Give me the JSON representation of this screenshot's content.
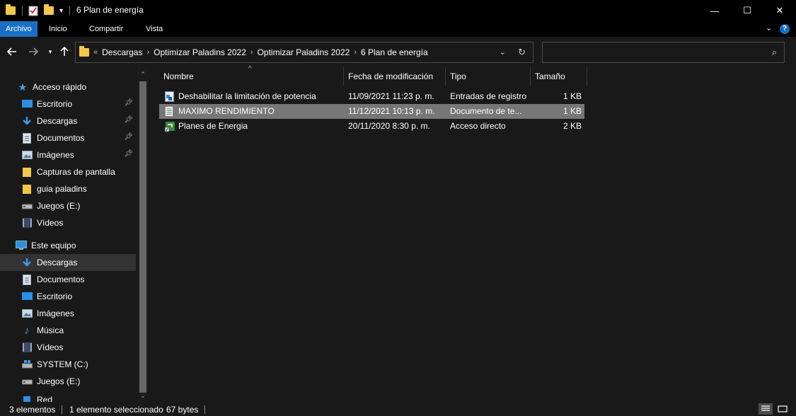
{
  "window": {
    "title": "6 Plan de energía",
    "minimize_glyph": "—",
    "maximize_glyph": "☐",
    "close_glyph": "✕"
  },
  "ribbon": {
    "tabs": [
      "Archivo",
      "Inicio",
      "Compartir",
      "Vista"
    ],
    "active_tab": "Archivo",
    "help_glyph": "?"
  },
  "nav": {
    "breadcrumb": [
      "Descargas",
      "Optimizar Paladins 2022",
      "Optimizar Paladins 2022",
      "6 Plan de energía"
    ],
    "overflow_glyph": "«",
    "search_placeholder": ""
  },
  "sidebar": {
    "quick_access": {
      "label": "Acceso rápido",
      "items": [
        {
          "label": "Escritorio",
          "icon": "desktop-icon",
          "pinned": true
        },
        {
          "label": "Descargas",
          "icon": "download-icon",
          "pinned": true
        },
        {
          "label": "Documentos",
          "icon": "documents-icon",
          "pinned": true
        },
        {
          "label": "Imágenes",
          "icon": "pictures-icon",
          "pinned": true
        },
        {
          "label": "Capturas de pantalla",
          "icon": "folder-icon",
          "pinned": false
        },
        {
          "label": "guia paladins",
          "icon": "folder-icon",
          "pinned": false
        },
        {
          "label": "Juegos (E:)",
          "icon": "drive-icon",
          "pinned": false
        },
        {
          "label": "Vídeos",
          "icon": "videos-icon",
          "pinned": false
        }
      ]
    },
    "this_pc": {
      "label": "Este equipo",
      "items": [
        {
          "label": "Descargas",
          "icon": "download-icon",
          "selected": true
        },
        {
          "label": "Documentos",
          "icon": "documents-icon"
        },
        {
          "label": "Escritorio",
          "icon": "desktop-icon"
        },
        {
          "label": "Imágenes",
          "icon": "pictures-icon"
        },
        {
          "label": "Música",
          "icon": "music-icon"
        },
        {
          "label": "Vídeos",
          "icon": "videos-icon"
        },
        {
          "label": "SYSTEM (C:)",
          "icon": "system-drive-icon"
        },
        {
          "label": "Juegos (E:)",
          "icon": "drive-icon"
        }
      ]
    },
    "cut_off_item": "Red"
  },
  "filelist": {
    "columns": [
      "Nombre",
      "Fecha de modificación",
      "Tipo",
      "Tamaño"
    ],
    "sort_glyph": "^",
    "rows": [
      {
        "name": "Deshabilitar la limitación de potencia",
        "date": "11/09/2021 11:23 p. m.",
        "type": "Entradas de registro",
        "size": "1 KB",
        "icon": "registry-file-icon",
        "selected": false
      },
      {
        "name": "MAXIMO RENDIMIENTO",
        "date": "11/12/2021 10:13 p. m.",
        "type": "Documento de te...",
        "size": "1 KB",
        "icon": "text-file-icon",
        "selected": true
      },
      {
        "name": "Planes de Energia",
        "date": "20/11/2020 8:30 p. m.",
        "type": "Acceso directo",
        "size": "2 KB",
        "icon": "shortcut-icon",
        "selected": false
      }
    ]
  },
  "status": {
    "count": "3 elementos",
    "selection": "1 elemento seleccionado",
    "bytes": "67 bytes"
  },
  "colors": {
    "accent": "#1a6fc4",
    "folder": "#f3c84a",
    "background": "#191919",
    "selection": "#777777"
  }
}
